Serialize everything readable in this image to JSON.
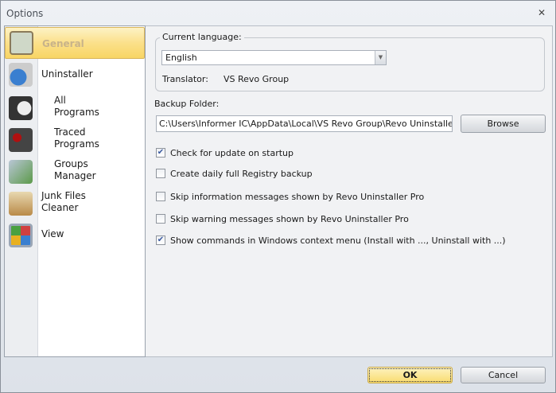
{
  "window": {
    "title": "Options",
    "close": "✕"
  },
  "sidebar": {
    "items": [
      {
        "label": "General",
        "icon": "general-clipboard-icon",
        "color": "#cfd8c8"
      },
      {
        "label": "Uninstaller",
        "icon": "uninstaller-icon",
        "color": "#3a7fd0"
      },
      {
        "label": "All Programs",
        "icon": "all-programs-icon",
        "color": "#555"
      },
      {
        "label": "Traced Programs",
        "icon": "traced-programs-icon",
        "color": "#7a2020"
      },
      {
        "label": "Groups Manager",
        "icon": "groups-manager-icon",
        "color": "#6c9a5a"
      },
      {
        "label": "Junk Files Cleaner",
        "icon": "junk-files-icon",
        "color": "#c49a50"
      },
      {
        "label": "View",
        "icon": "view-icon",
        "color": "#8fa0b8"
      }
    ]
  },
  "general": {
    "language_label": "Current language:",
    "language_value": "English",
    "translator_label": "Translator:",
    "translator_value": "VS Revo Group",
    "backup_label": "Backup Folder:",
    "backup_path": "C:\\Users\\Informer IC\\AppData\\Local\\VS Revo Group\\Revo Uninstaller Pro\\Ba",
    "browse": "Browse",
    "options": [
      {
        "label": "Check for update on startup",
        "checked": true
      },
      {
        "label": "Create daily full Registry backup",
        "checked": false
      },
      {
        "label": "Skip information messages shown by Revo Uninstaller Pro",
        "checked": false
      },
      {
        "label": "Skip warning messages shown by Revo Uninstaller Pro",
        "checked": false
      },
      {
        "label": "Show commands in Windows context menu (Install with ..., Uninstall with ...)",
        "checked": true
      }
    ]
  },
  "footer": {
    "ok": "OK",
    "cancel": "Cancel"
  }
}
